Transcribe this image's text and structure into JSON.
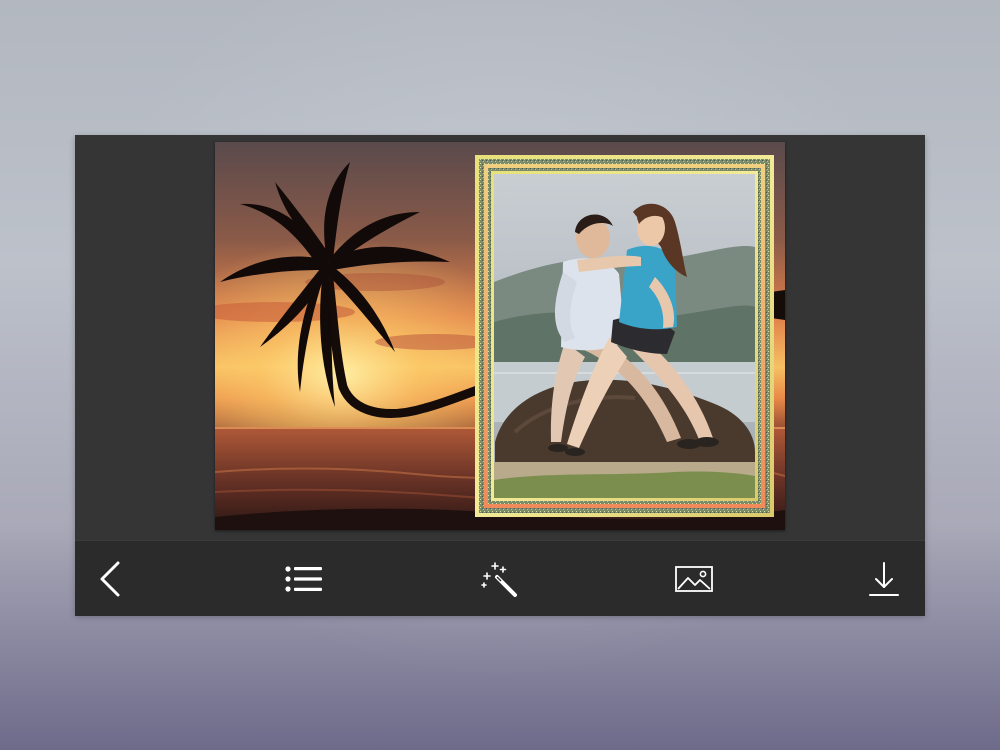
{
  "app": {
    "accent_color": "#ffffff",
    "toolbar_background": "#2b2b2c"
  },
  "editor": {
    "background_scene": "beach-sunset-palm-tree",
    "photo_subject": "couple-sitting-on-rock",
    "frame_style": "gold-green-glitter-frame"
  },
  "toolbar": {
    "items": [
      {
        "id": "back",
        "icon": "chevron-left-icon"
      },
      {
        "id": "frames",
        "icon": "list-icon"
      },
      {
        "id": "effects",
        "icon": "magic-wand-icon"
      },
      {
        "id": "gallery",
        "icon": "image-icon"
      },
      {
        "id": "save",
        "icon": "download-icon"
      }
    ]
  }
}
